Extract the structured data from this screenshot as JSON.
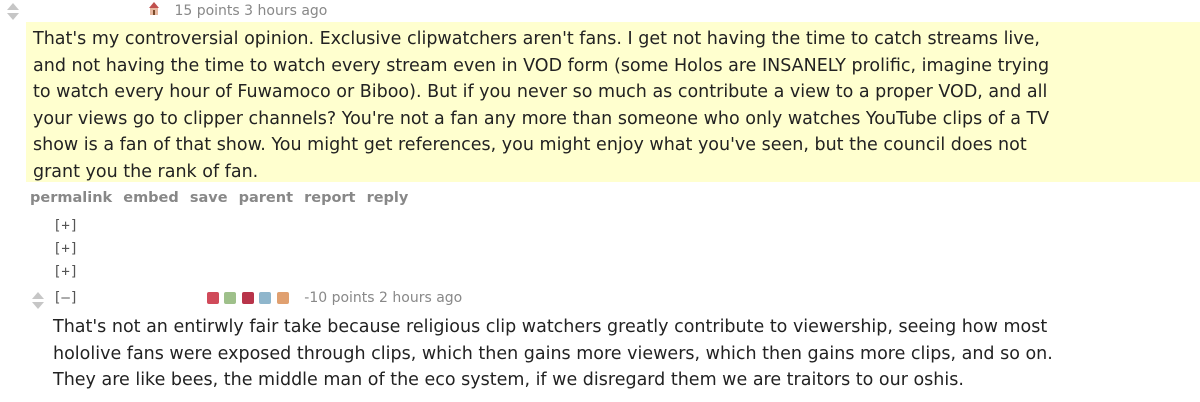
{
  "comment1": {
    "score": "15 points",
    "time": "3 hours ago",
    "body_lines": [
      "That's my controversial opinion. Exclusive clipwatchers aren't fans. I get not having the time to catch streams live,",
      "and not having the time to watch every stream even in VOD form (some Holos are INSANELY prolific, imagine trying",
      "to watch every hour of Fuwamoco or Biboo). But if you never so much as contribute a view to a proper VOD, and all",
      "your views go to clipper channels? You're not a fan any more than someone who only watches YouTube clips of a TV",
      "show is a fan of that show. You might get references, you might enjoy what you've seen, but the council does not",
      "grant you the rank of fan."
    ],
    "buttons": [
      "permalink",
      "embed",
      "save",
      "parent",
      "report",
      "reply"
    ]
  },
  "collapsed_children": [
    "[+]",
    "[+]",
    "[+]"
  ],
  "comment2": {
    "toggle": "[–]",
    "score": "-10 points",
    "time": "2 hours ago",
    "body_lines": [
      "That's not an entirwly fair take because religious clip watchers greatly contribute to viewership, seeing how most",
      "hololive fans were exposed through clips, which then gains more viewers, which then gains more clips, and so on.",
      "They are like bees, the middle man of the eco system, if we disregard them we are traitors to our oshis."
    ]
  },
  "colors": {
    "highlight": "#ffffcf",
    "meta": "#888888",
    "text": "#222222",
    "arrow": "#c6c6c6"
  }
}
